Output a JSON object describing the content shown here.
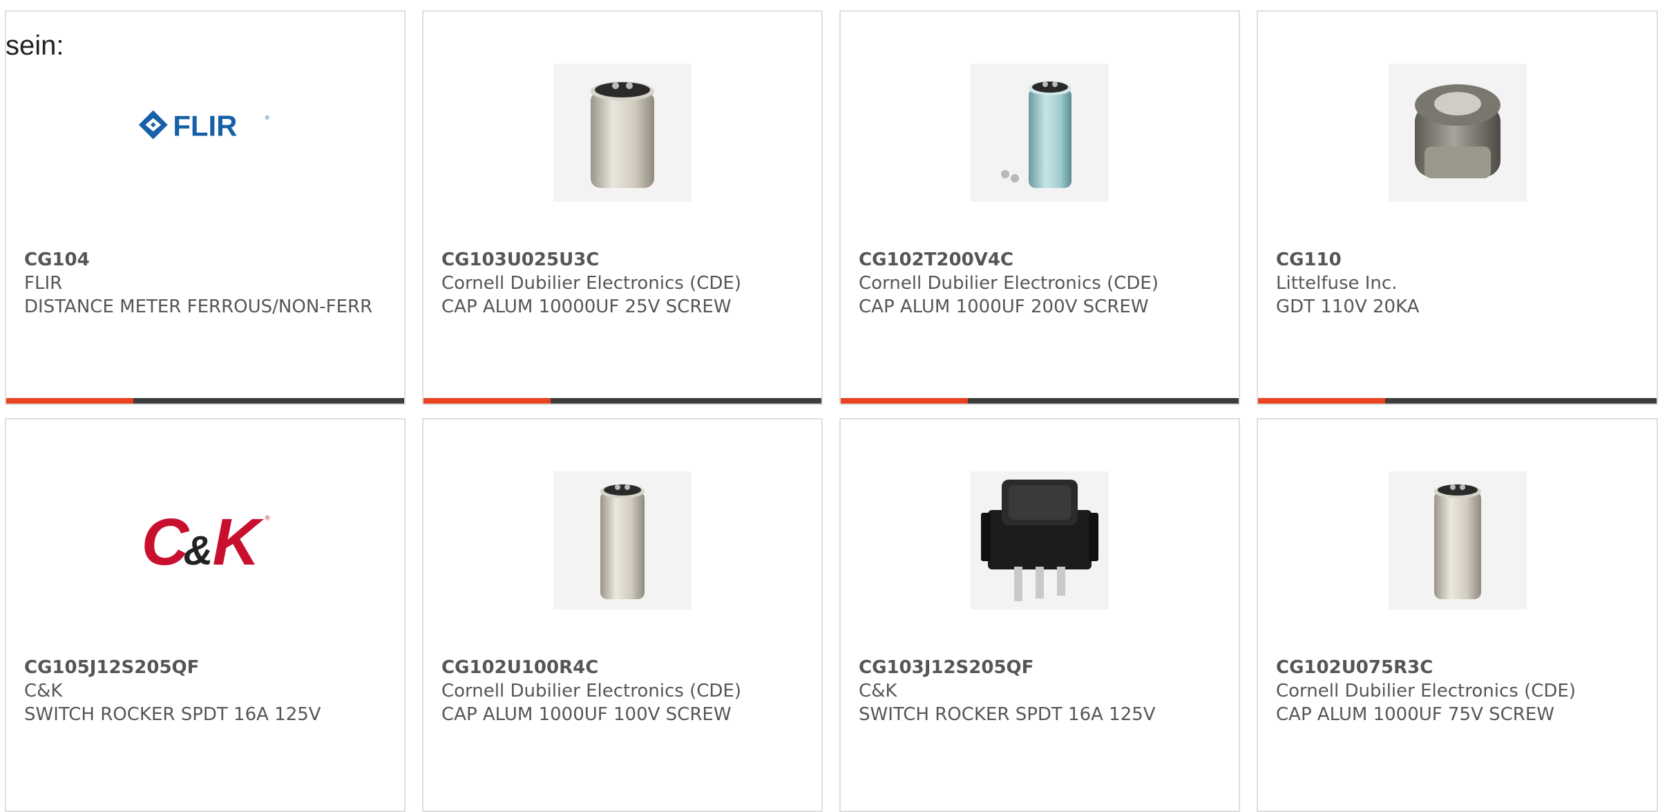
{
  "prefix_text": "sein:",
  "colors": {
    "accent_red": "#e8421e",
    "accent_dark": "#3d3d3d",
    "flir_blue": "#1660a8",
    "ck_red": "#c8102e",
    "text_gray": "#555555"
  },
  "products": [
    {
      "part_number": "CG104",
      "manufacturer": "FLIR",
      "description": "DISTANCE METER FERROUS/NON-FERR",
      "image": "flir-logo"
    },
    {
      "part_number": "CG103U025U3C",
      "manufacturer": "Cornell Dubilier Electronics (CDE)",
      "description": "CAP ALUM 10000UF 25V SCREW",
      "image": "capacitor-photo"
    },
    {
      "part_number": "CG102T200V4C",
      "manufacturer": "Cornell Dubilier Electronics (CDE)",
      "description": "CAP ALUM 1000UF 200V SCREW",
      "image": "capacitor-blue-photo"
    },
    {
      "part_number": "CG110",
      "manufacturer": "Littelfuse Inc.",
      "description": "GDT 110V 20KA",
      "image": "gdt-photo"
    },
    {
      "part_number": "CG105J12S205QF",
      "manufacturer": "C&K",
      "description": "SWITCH ROCKER SPDT 16A 125V",
      "image": "ck-logo"
    },
    {
      "part_number": "CG102U100R4C",
      "manufacturer": "Cornell Dubilier Electronics (CDE)",
      "description": "CAP ALUM 1000UF 100V SCREW",
      "image": "capacitor-photo"
    },
    {
      "part_number": "CG103J12S205QF",
      "manufacturer": "C&K",
      "description": "SWITCH ROCKER SPDT 16A 125V",
      "image": "rocker-switch-photo"
    },
    {
      "part_number": "CG102U075R3C",
      "manufacturer": "Cornell Dubilier Electronics (CDE)",
      "description": "CAP ALUM 1000UF 75V SCREW",
      "image": "capacitor-photo"
    }
  ]
}
